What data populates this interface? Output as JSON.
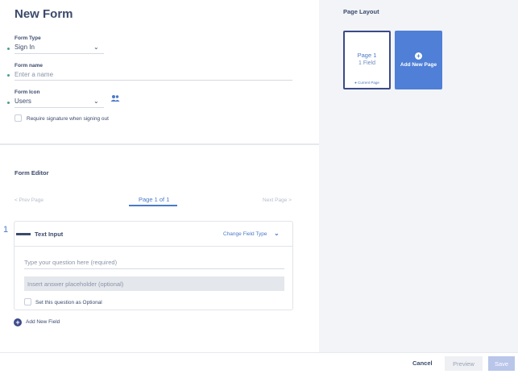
{
  "form": {
    "title": "New Form",
    "type_label": "Form Type",
    "type_value": "Sign In",
    "name_label": "Form name",
    "name_placeholder": "Enter a name",
    "icon_label": "Form Icon",
    "icon_value": "Users",
    "icon_name": "users-icon",
    "signature_label": "Require signature when signing out"
  },
  "editor": {
    "title": "Form Editor",
    "prev_page": "< Prev Page",
    "current_page": "Page 1 of 1",
    "next_page": "Next Page >",
    "question_number": "1",
    "field_type": "Text Input",
    "change_field_type": "Change Field Type",
    "question_placeholder": "Type your question here (required)",
    "answer_placeholder": "Insert answer placeholder (optional)",
    "optional_label": "Set this question as Optional",
    "add_field": "Add New Field"
  },
  "page_layout": {
    "title": "Page Layout",
    "page_name": "Page 1",
    "page_fields": "1 Field",
    "current_marker": "Current Page",
    "add_page": "Add New Page"
  },
  "footer": {
    "cancel": "Cancel",
    "preview": "Preview",
    "save": "Save"
  },
  "colors": {
    "accent": "#4b79c8",
    "navy": "#3b4a8a",
    "panel_bg": "#f2f4f7"
  }
}
